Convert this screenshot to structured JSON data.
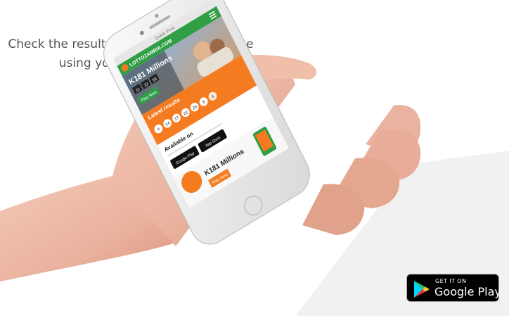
{
  "headline": {
    "line1": "Check the results anywhere and anytime",
    "line2": "using your smartphone!"
  },
  "phone": {
    "browser_title": "Quick Print",
    "site_logo": "LOTTOZAMBIA.COM",
    "jackpot_amount": "K181 Millions",
    "countdown": [
      "11",
      "22",
      "55"
    ],
    "play_now": "Play Now",
    "latest_results_title": "Latest results",
    "result_balls": [
      "4",
      "14",
      "17",
      "22",
      "29",
      "8",
      "4"
    ],
    "available_on": "Available on",
    "store_google": "Google Play",
    "store_apple": "App Store",
    "promo_amount": "K181 Millions",
    "promo_play_now": "Play Now"
  },
  "badge": {
    "get_it_on": "GET IT ON",
    "store_name": "Google Play"
  },
  "colors": {
    "brand_orange": "#f47b20",
    "brand_green": "#2f9e44",
    "headline_text": "#555555",
    "badge_bg": "#000000"
  }
}
